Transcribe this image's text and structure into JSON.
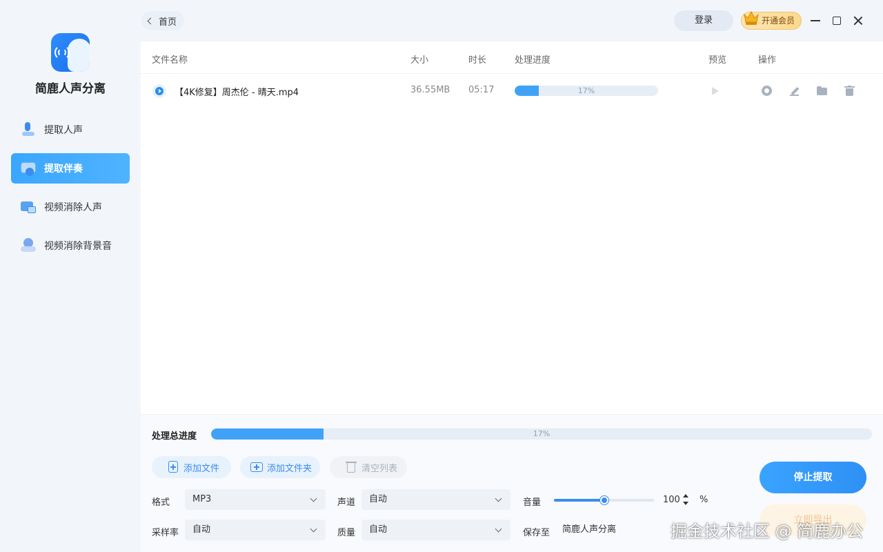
{
  "app": {
    "name": "简鹿人声分离"
  },
  "sidebar": {
    "items": [
      {
        "label": "提取人声",
        "icon": "mic-icon"
      },
      {
        "label": "提取伴奏",
        "icon": "accompaniment-icon",
        "active": true
      },
      {
        "label": "视频消除人声",
        "icon": "video-icon"
      },
      {
        "label": "视频消除背景音",
        "icon": "bg-sound-icon"
      }
    ]
  },
  "topbar": {
    "back_label": "首页",
    "login_label": "登录",
    "vip_label": "开通会员"
  },
  "table": {
    "columns": [
      "文件名称",
      "大小",
      "时长",
      "处理进度",
      "预览",
      "操作"
    ],
    "rows": [
      {
        "name": "【4K修复】周杰伦 - 晴天.mp4",
        "size": "36.55MB",
        "duration": "05:17",
        "progress": 17,
        "progress_text": "17%"
      }
    ]
  },
  "total": {
    "label": "处理总进度",
    "progress": 17,
    "progress_text": "17%"
  },
  "actions": {
    "add_file": "添加文件",
    "add_folder": "添加文件夹",
    "clear_list": "清空列表"
  },
  "options": {
    "format_label": "格式",
    "format_value": "MP3",
    "channel_label": "声道",
    "channel_value": "自动",
    "volume_label": "音量",
    "volume_value": "100",
    "volume_unit": "%",
    "volume_fraction": 0.5,
    "sample_rate_label": "采样率",
    "sample_rate_value": "自动",
    "quality_label": "质量",
    "quality_value": "自动",
    "save_label": "保存至",
    "save_value": "简鹿人声分离"
  },
  "buttons": {
    "stop": "停止提取",
    "open_folder": "立即导出"
  },
  "watermark": "掘金技术社区 @ 简鹿办公",
  "colors": {
    "accent": "#3aa3ff",
    "vip": "#ffd88c"
  }
}
